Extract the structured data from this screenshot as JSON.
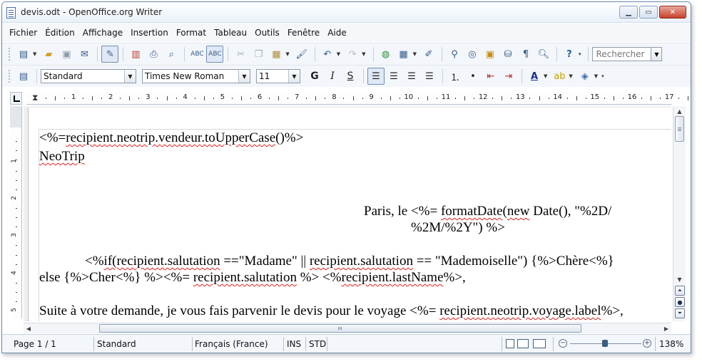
{
  "window": {
    "title": "devis.odt - OpenOffice.org Writer",
    "minimize": "▁",
    "maximize": "▭",
    "close": "✕"
  },
  "menu": [
    "Fichier",
    "Édition",
    "Affichage",
    "Insertion",
    "Format",
    "Tableau",
    "Outils",
    "Fenêtre",
    "Aide"
  ],
  "toolbar": {
    "search_placeholder": "Rechercher"
  },
  "formatting": {
    "paragraph_style": "Standard",
    "font_name": "Times New Roman",
    "font_size": "11",
    "bold": "G",
    "italic": "I",
    "underline": "S"
  },
  "ruler": {
    "horizontal_labels": [
      "1",
      "2",
      "3",
      "4",
      "5",
      "6",
      "7",
      "8",
      "9",
      "10",
      "11",
      "12",
      "13",
      "14",
      "15",
      "16",
      "17"
    ],
    "vertical_labels": [
      "1",
      "2",
      "3",
      "4",
      "5"
    ]
  },
  "document": {
    "line1_a": "<%=",
    "line1_b": "recipient.neotrip.vendeur.toUpperCase",
    "line1_c": "()%>",
    "line2": "NeoTrip",
    "line3_a": "Paris, le <%= ",
    "line3_b": "formatDate",
    "line3_c": "(",
    "line3_d": "new",
    "line3_e": " Date(), \"%2D/",
    "line4": "%2M/%2Y\") %>",
    "line5_a": "<%",
    "line5_b": "if(recipient.salutation",
    "line5_c": " ==\"Madame\" || ",
    "line5_d": "recipient.salutation",
    "line5_e": " == \"Mademoiselle\") {%>Chère<%}",
    "line6_a": "else {%>Cher<%} %><%= ",
    "line6_b": "recipient.salutation",
    "line6_c": " %> <%",
    "line6_d": "recipient.lastName",
    "line6_e": "%>,",
    "line7_a": "Suite à votre demande, je vous fais parvenir le devis pour le voyage <%= ",
    "line7_b": "recipient.neotrip.voyage.label",
    "line7_c": "%>,"
  },
  "status": {
    "page": "Page 1 / 1",
    "style": "Standard",
    "language": "Français (France)",
    "insert_mode": "INS",
    "selection_mode": "STD",
    "zoom": "138%"
  },
  "colors": {
    "spell_underline": "#e02020",
    "accent": "#355a8a"
  }
}
